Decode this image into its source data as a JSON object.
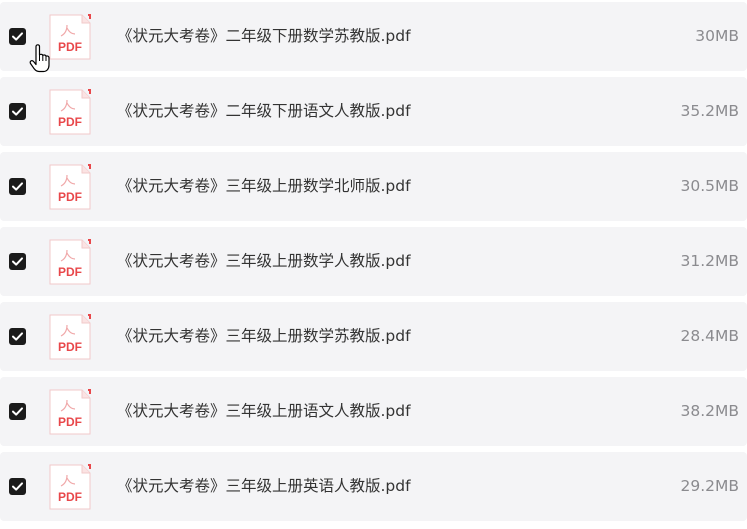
{
  "files": [
    {
      "name": "《状元大考卷》二年级下册数学苏教版.pdf",
      "size": "30MB",
      "checked": true
    },
    {
      "name": "《状元大考卷》二年级下册语文人教版.pdf",
      "size": "35.2MB",
      "checked": true
    },
    {
      "name": "《状元大考卷》三年级上册数学北师版.pdf",
      "size": "30.5MB",
      "checked": true
    },
    {
      "name": "《状元大考卷》三年级上册数学人教版.pdf",
      "size": "31.2MB",
      "checked": true
    },
    {
      "name": "《状元大考卷》三年级上册数学苏教版.pdf",
      "size": "28.4MB",
      "checked": true
    },
    {
      "name": "《状元大考卷》三年级上册语文人教版.pdf",
      "size": "38.2MB",
      "checked": true
    },
    {
      "name": "《状元大考卷》三年级上册英语人教版.pdf",
      "size": "29.2MB",
      "checked": true
    }
  ],
  "icons": {
    "file": "pdf-file-icon",
    "check": "checkmark-icon",
    "cursor": "hand-pointer-icon"
  },
  "file_type_label": "PDF",
  "colors": {
    "row_background": "#f4f4f6",
    "checkbox_fill": "#1b1b1b",
    "pdf_red": "#e8474a",
    "name_text": "#333333",
    "size_text": "#8b8b8f"
  }
}
